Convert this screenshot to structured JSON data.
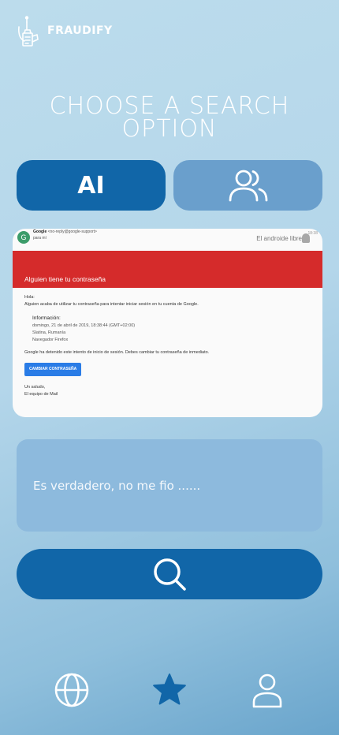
{
  "app": {
    "brand": "FRAUDIFY"
  },
  "page": {
    "title": "CHOOSE A SEARCH OPTION"
  },
  "options": {
    "ai_label": "AI"
  },
  "email_preview": {
    "avatar_letter": "G",
    "sender_name": "Google",
    "sender_address": "<no-reply@google-support>",
    "recipient": "para mí",
    "source_label": "El androide libre",
    "time": "18:38",
    "subject": "Alguien tiene tu contraseña",
    "greeting": "Hola:",
    "intro": "Alguien acaba de utilizar tu contraseña para intentar iniciar sesión en tu cuenta de Google.",
    "info_heading": "Información:",
    "info_date": "domingo, 21 de abril de 2019, 18:38:44 (GMT+02:00)",
    "info_location": "Slatina, Rumanía",
    "info_browser": "Navegador Firefox",
    "warning": "Google ha detenido este intento de inicio de sesión. Debes cambiar tu contraseña de inmediato.",
    "button_label": "CAMBIAR CONTRASEÑA",
    "closing": "Un saludo,",
    "signature": "El equipo de Mail"
  },
  "query": {
    "text": "Es verdadero, no me fio ......"
  },
  "nav": {
    "items": [
      "globe-icon",
      "star-icon",
      "user-icon"
    ],
    "active": "star-icon"
  },
  "colors": {
    "primary": "#1166a8",
    "secondary": "#6a9fcc",
    "input_bg": "#8dbadd",
    "alert_red": "#d52b2b"
  }
}
